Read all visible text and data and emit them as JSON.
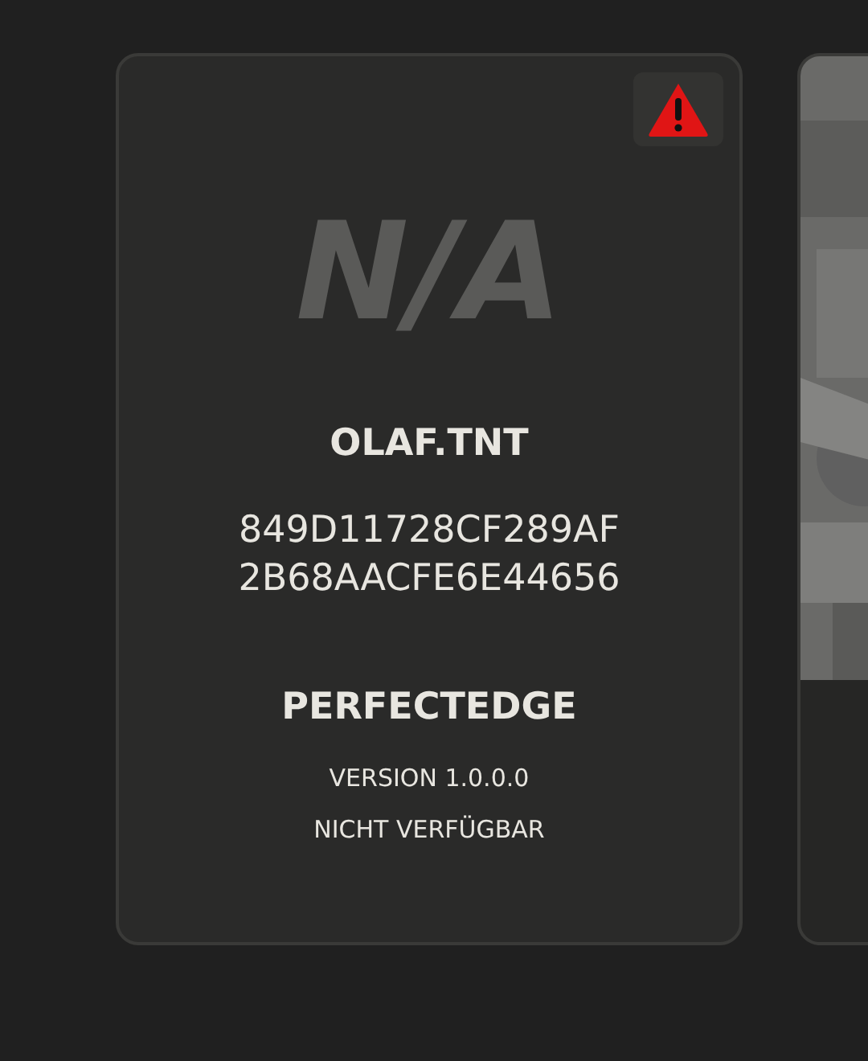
{
  "cards": [
    {
      "kind": "mod",
      "warning": true,
      "placeholder_logo": "N/A",
      "author": "OLAF.TNT",
      "hash_lines": [
        "849D11728CF289AF",
        "2B68AACFE6E44656"
      ],
      "name": "PERFECTEDGE",
      "version": "VERSION 1.0.0.0",
      "status": "NICHT VERFÜGBAR"
    },
    {
      "kind": "partial"
    }
  ]
}
